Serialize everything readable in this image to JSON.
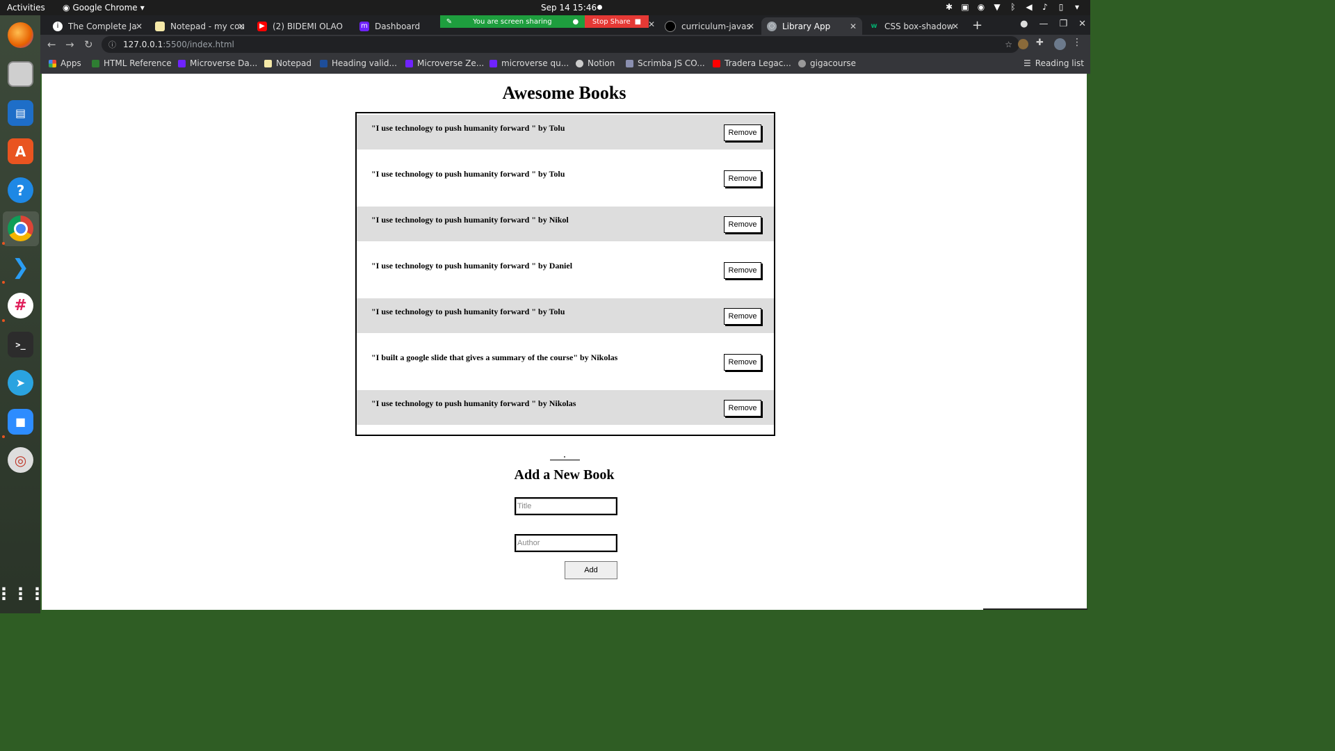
{
  "system_bar": {
    "activities": "Activities",
    "app_name": "Google Chrome",
    "clock": "Sep 14  15:46"
  },
  "dock": {
    "icons": [
      "firefox-icon",
      "files-icon",
      "writer-icon",
      "software-icon",
      "help-icon",
      "chrome-icon",
      "vscode-icon",
      "slack-icon",
      "terminal-icon",
      "telegram-icon",
      "zoom-icon",
      "lifesaver-icon",
      "app-grid-icon"
    ]
  },
  "browser": {
    "tabs": [
      {
        "label": "The Complete Ja"
      },
      {
        "label": "Notepad - my cou"
      },
      {
        "label": "(2) BIDEMI OLAO"
      },
      {
        "label": "Dashboard"
      },
      {
        "label": "curriculum-javas"
      },
      {
        "label": "Library App"
      },
      {
        "label": "CSS box-shadow"
      }
    ],
    "share_banner": {
      "message": "You are screen sharing",
      "stop_label": "Stop Share"
    },
    "url": {
      "host": "127.0.0.1",
      "path": ":5500/index.html"
    },
    "bookmarks": [
      {
        "label": "Apps"
      },
      {
        "label": "HTML Reference"
      },
      {
        "label": "Microverse Da..."
      },
      {
        "label": "Notepad"
      },
      {
        "label": "Heading valid..."
      },
      {
        "label": "Microverse Ze..."
      },
      {
        "label": "microverse qu..."
      },
      {
        "label": "Notion"
      },
      {
        "label": "Scrimba JS CO..."
      },
      {
        "label": "Tradera Legac..."
      },
      {
        "label": "gigacourse"
      }
    ],
    "reading_list": "Reading list"
  },
  "page": {
    "heading": "Awesome Books",
    "books": [
      {
        "text": "\"I use technology to push humanity forward \" by Tolu",
        "remove_label": "Remove"
      },
      {
        "text": "\"I use technology to push humanity forward \" by Tolu",
        "remove_label": "Remove"
      },
      {
        "text": "\"I use technology to push humanity forward \" by Nikol",
        "remove_label": "Remove"
      },
      {
        "text": "\"I use technology to push humanity forward \" by Daniel",
        "remove_label": "Remove"
      },
      {
        "text": "\"I use technology to push humanity forward \" by Tolu",
        "remove_label": "Remove"
      },
      {
        "text": "\"I built a google slide that gives a summary of the course\" by Nikolas",
        "remove_label": "Remove"
      },
      {
        "text": "\"I use technology to push humanity forward \" by Nikolas",
        "remove_label": "Remove"
      }
    ],
    "form": {
      "heading": "Add a New Book",
      "title_placeholder": "Title",
      "title_value": "",
      "author_placeholder": "Author",
      "author_value": "",
      "add_label": "Add"
    }
  }
}
